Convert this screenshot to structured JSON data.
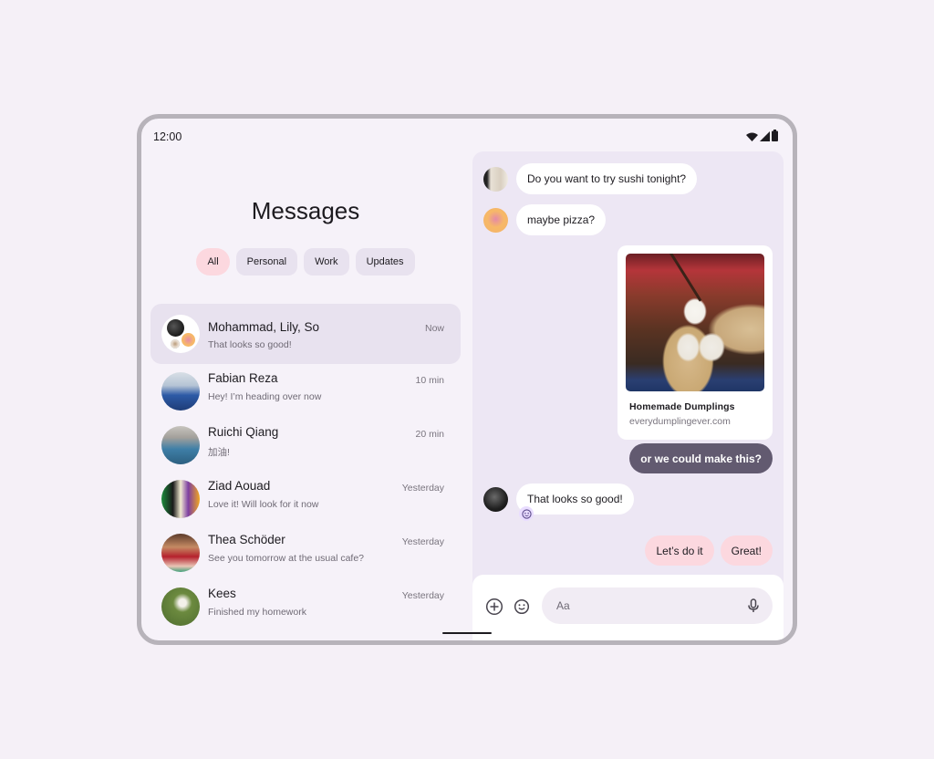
{
  "status_bar": {
    "time": "12:00",
    "icons": [
      "wifi-icon",
      "signal-icon",
      "battery-icon"
    ]
  },
  "list": {
    "title": "Messages",
    "filters": [
      {
        "label": "All",
        "active": true
      },
      {
        "label": "Personal",
        "active": false
      },
      {
        "label": "Work",
        "active": false
      },
      {
        "label": "Updates",
        "active": false
      }
    ],
    "conversations": [
      {
        "name": "Mohammad, Lily, So",
        "preview": "That looks so good!",
        "time": "Now",
        "selected": true
      },
      {
        "name": "Fabian Reza",
        "preview": "Hey! I’m heading over now",
        "time": "10 min"
      },
      {
        "name": "Ruichi Qiang",
        "preview": "加油!",
        "time": "20 min"
      },
      {
        "name": "Ziad Aouad",
        "preview": "Love it! Will look for it now",
        "time": "Yesterday"
      },
      {
        "name": "Thea Schöder",
        "preview": "See you tomorrow at the usual cafe?",
        "time": "Yesterday"
      },
      {
        "name": "Kees",
        "preview": "Finished my homework",
        "time": "Yesterday"
      }
    ]
  },
  "chat": {
    "messages": [
      {
        "text": "Do you want to try sushi tonight?",
        "direction": "incoming"
      },
      {
        "text": "maybe pizza?",
        "direction": "incoming"
      },
      {
        "type": "link",
        "title": "Homemade Dumplings",
        "url": "everydumplingever.com",
        "direction": "outgoing"
      },
      {
        "text": "or we could make this?",
        "direction": "outgoing"
      },
      {
        "text": "That looks so good!",
        "direction": "incoming",
        "reaction": "smile-emoji"
      }
    ],
    "suggestions": [
      "Let’s do it",
      "Great!"
    ],
    "composer": {
      "placeholder": "Aa"
    }
  },
  "colors": {
    "background": "#f5f0f7",
    "chat_background": "#ede7f4",
    "chip_active": "#fcd8df",
    "chip": "#e8e2ef",
    "sent_bubble": "#625a70",
    "suggestion": "#fcd8df"
  }
}
